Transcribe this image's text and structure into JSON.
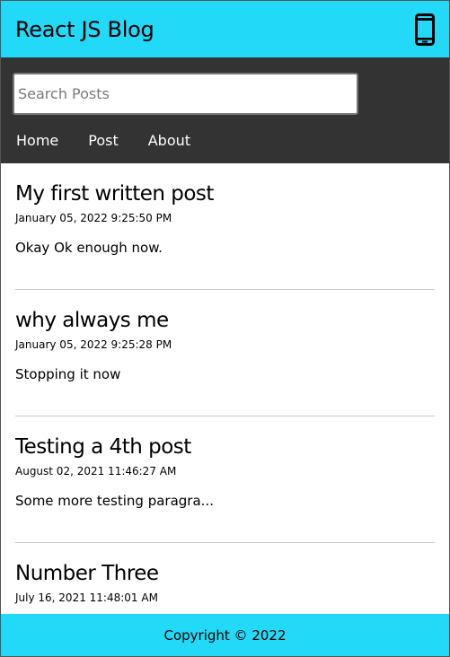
{
  "header": {
    "title": "React JS Blog",
    "device_icon": "mobile-phone-icon"
  },
  "nav": {
    "search_placeholder": "Search Posts",
    "search_value": "",
    "links": [
      {
        "label": "Home"
      },
      {
        "label": "Post"
      },
      {
        "label": "About"
      }
    ]
  },
  "posts": [
    {
      "title": "My first written post",
      "date": "January 05, 2022 9:25:50 PM",
      "body": "Okay Ok enough now."
    },
    {
      "title": "why always me",
      "date": "January 05, 2022 9:25:28 PM",
      "body": "Stopping it now"
    },
    {
      "title": "Testing a 4th post",
      "date": "August 02, 2021 11:46:27 AM",
      "body": "Some more testing paragra..."
    },
    {
      "title": "Number Three",
      "date": "July 16, 2021 11:48:01 AM",
      "body": ""
    }
  ],
  "footer": {
    "text": "Copyright © 2022"
  },
  "colors": {
    "accent": "#22d9f7",
    "nav_background": "#333333",
    "divider": "#cccccc"
  }
}
